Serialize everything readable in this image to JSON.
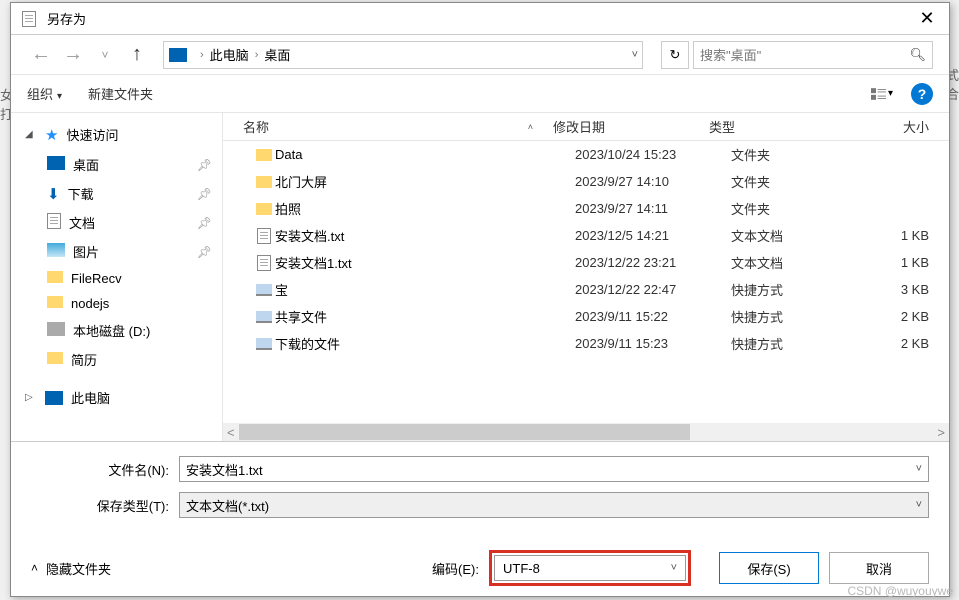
{
  "window": {
    "title": "另存为"
  },
  "nav": {
    "pc": "此电脑",
    "desktop": "桌面"
  },
  "search": {
    "placeholder": "搜索\"桌面\""
  },
  "toolbar": {
    "organize": "组织",
    "new_folder": "新建文件夹"
  },
  "sidebar": {
    "quick_access": "快速访问",
    "items": [
      {
        "label": "桌面",
        "pinned": true,
        "icon": "desk"
      },
      {
        "label": "下载",
        "pinned": true,
        "icon": "dl"
      },
      {
        "label": "文档",
        "pinned": true,
        "icon": "doc"
      },
      {
        "label": "图片",
        "pinned": true,
        "icon": "img"
      },
      {
        "label": "FileRecv",
        "pinned": false,
        "icon": "folder"
      },
      {
        "label": "nodejs",
        "pinned": false,
        "icon": "folder"
      },
      {
        "label": "本地磁盘 (D:)",
        "pinned": false,
        "icon": "disk"
      },
      {
        "label": "简历",
        "pinned": false,
        "icon": "folder"
      }
    ],
    "this_pc": "此电脑"
  },
  "columns": {
    "name": "名称",
    "date": "修改日期",
    "type": "类型",
    "size": "大小"
  },
  "files": [
    {
      "name": "Data",
      "date": "2023/10/24 15:23",
      "type": "文件夹",
      "size": "",
      "icon": "folder"
    },
    {
      "name": "北门大屏",
      "date": "2023/9/27 14:10",
      "type": "文件夹",
      "size": "",
      "icon": "folder"
    },
    {
      "name": "拍照",
      "date": "2023/9/27 14:11",
      "type": "文件夹",
      "size": "",
      "icon": "folder"
    },
    {
      "name": "安装文档.txt",
      "date": "2023/12/5 14:21",
      "type": "文本文档",
      "size": "1 KB",
      "icon": "txt"
    },
    {
      "name": "安装文档1.txt",
      "date": "2023/12/22 23:21",
      "type": "文本文档",
      "size": "1 KB",
      "icon": "txt"
    },
    {
      "name": "宝",
      "date": "2023/12/22 22:47",
      "type": "快捷方式",
      "size": "3 KB",
      "icon": "lnk"
    },
    {
      "name": "共享文件",
      "date": "2023/9/11 15:22",
      "type": "快捷方式",
      "size": "2 KB",
      "icon": "lnk"
    },
    {
      "name": "下载的文件",
      "date": "2023/9/11 15:23",
      "type": "快捷方式",
      "size": "2 KB",
      "icon": "lnk"
    }
  ],
  "form": {
    "filename_label": "文件名(N):",
    "filename_value": "安装文档1.txt",
    "savetype_label": "保存类型(T):",
    "savetype_value": "文本文档(*.txt)",
    "hide_folders": "隐藏文件夹",
    "encoding_label": "编码(E):",
    "encoding_value": "UTF-8",
    "save": "保存(S)",
    "cancel": "取消"
  },
  "watermark": "CSDN @wuyouywe"
}
